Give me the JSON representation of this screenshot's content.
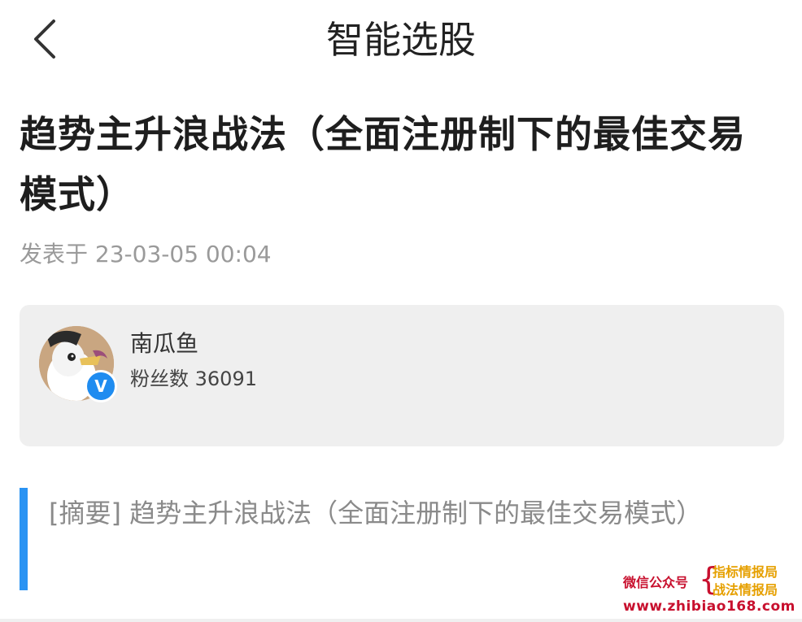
{
  "nav": {
    "back_icon": "chevron-left-icon",
    "title": "智能选股"
  },
  "article": {
    "title": "趋势主升浪战法（全面注册制下的最佳交易模式）",
    "publish_label": "发表于",
    "publish_time": "23-03-05 00:04"
  },
  "author": {
    "name": "南瓜鱼",
    "fans_label": "粉丝数",
    "fans_count": "36091",
    "verified_icon": "verified-v-icon",
    "verified_symbol": "V"
  },
  "summary": {
    "text": "[摘要] 趋势主升浪战法（全面注册制下的最佳交易模式）"
  },
  "watermark": {
    "left": "微信公众号",
    "brace": "{",
    "right_line1": "指标情报局",
    "right_line2": "战法情报局",
    "url": "www.zhibiao168.com"
  },
  "colors": {
    "accent": "#2a93f3",
    "card_bg": "#efefef",
    "watermark_red": "#c8102e",
    "watermark_gold": "#e6a000"
  }
}
